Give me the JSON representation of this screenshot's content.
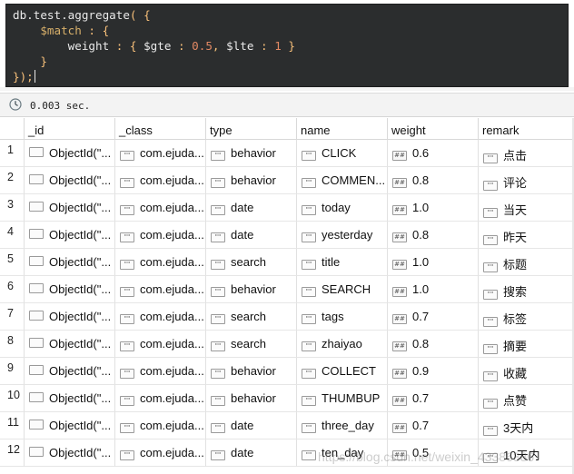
{
  "editor": {
    "lines": [
      "db.test.aggregate( {",
      "    $match : {",
      "        weight : { $gte : 0.5, $lte : 1 }",
      "    }",
      "});"
    ]
  },
  "status": {
    "clock_icon": "clock-icon",
    "time_text": "0.003 sec."
  },
  "columns": [
    "_id",
    "_class",
    "type",
    "name",
    "weight",
    "remark"
  ],
  "rows": [
    {
      "num": "1",
      "id": "ObjectId(\"...",
      "class": "com.ejuda...",
      "type": "behavior",
      "name": "CLICK",
      "weight": "0.6",
      "remark": "点击"
    },
    {
      "num": "2",
      "id": "ObjectId(\"...",
      "class": "com.ejuda...",
      "type": "behavior",
      "name": "COMMEN...",
      "weight": "0.8",
      "remark": "评论"
    },
    {
      "num": "3",
      "id": "ObjectId(\"...",
      "class": "com.ejuda...",
      "type": "date",
      "name": "today",
      "weight": "1.0",
      "remark": "当天"
    },
    {
      "num": "4",
      "id": "ObjectId(\"...",
      "class": "com.ejuda...",
      "type": "date",
      "name": "yesterday",
      "weight": "0.8",
      "remark": "昨天"
    },
    {
      "num": "5",
      "id": "ObjectId(\"...",
      "class": "com.ejuda...",
      "type": "search",
      "name": "title",
      "weight": "1.0",
      "remark": "标题"
    },
    {
      "num": "6",
      "id": "ObjectId(\"...",
      "class": "com.ejuda...",
      "type": "behavior",
      "name": "SEARCH",
      "weight": "1.0",
      "remark": "搜索"
    },
    {
      "num": "7",
      "id": "ObjectId(\"...",
      "class": "com.ejuda...",
      "type": "search",
      "name": "tags",
      "weight": "0.7",
      "remark": "标签"
    },
    {
      "num": "8",
      "id": "ObjectId(\"...",
      "class": "com.ejuda...",
      "type": "search",
      "name": "zhaiyao",
      "weight": "0.8",
      "remark": "摘要"
    },
    {
      "num": "9",
      "id": "ObjectId(\"...",
      "class": "com.ejuda...",
      "type": "behavior",
      "name": "COLLECT",
      "weight": "0.9",
      "remark": "收藏"
    },
    {
      "num": "10",
      "id": "ObjectId(\"...",
      "class": "com.ejuda...",
      "type": "behavior",
      "name": "THUMBUP",
      "weight": "0.7",
      "remark": "点赞"
    },
    {
      "num": "11",
      "id": "ObjectId(\"...",
      "class": "com.ejuda...",
      "type": "date",
      "name": "three_day",
      "weight": "0.7",
      "remark": "3天内"
    },
    {
      "num": "12",
      "id": "ObjectId(\"...",
      "class": "com.ejuda...",
      "type": "date",
      "name": "ten_day",
      "weight": "0.5",
      "remark": "10天内"
    }
  ],
  "badges": {
    "string_icon": "string-type-icon",
    "number_icon": "number-type-icon",
    "object_icon": "object-type-icon",
    "string_glyph": "\"\"",
    "number_glyph": "##"
  },
  "watermark": "https://blog.csdn.net/weixin_43386386",
  "colors": {
    "editor_bg": "#2b2d2e",
    "editor_text": "#e9e9e9",
    "editor_accent": "#d8b06a",
    "grid_border": "#d9d9d9"
  }
}
